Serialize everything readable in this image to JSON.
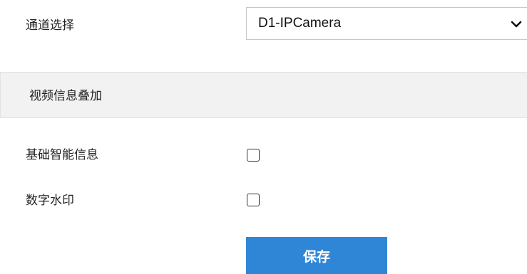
{
  "channel": {
    "label": "通道选择",
    "selected_value": "D1-IPCamera",
    "dropdown_icon": "chevron-down-icon"
  },
  "section": {
    "title": "视频信息叠加"
  },
  "options": [
    {
      "label": "基础智能信息",
      "checked": false
    },
    {
      "label": "数字水印",
      "checked": false
    }
  ],
  "actions": {
    "save_label": "保存"
  },
  "colors": {
    "primary_button": "#2f86d6",
    "section_bg": "#f2f2f2",
    "border": "#c8c8c8"
  }
}
